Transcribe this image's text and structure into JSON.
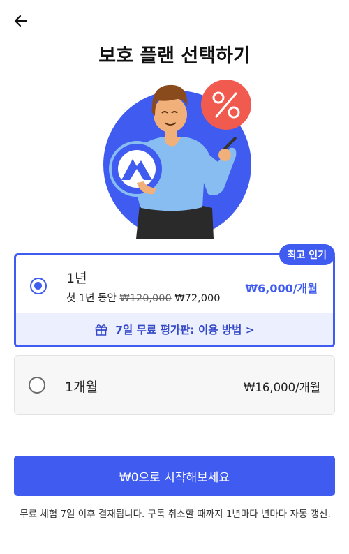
{
  "header": {
    "title": "보호 플랜 선택하기"
  },
  "icons": {
    "back": "back-arrow-icon",
    "gift": "gift-icon",
    "discount": "percent-icon",
    "logo": "mountain-logo-icon"
  },
  "colors": {
    "accent": "#3f5bf0",
    "accent_light": "#eceffd",
    "discount_red": "#f05a4f"
  },
  "plans": [
    {
      "name": "1년",
      "badge": "최고 인기",
      "sub_prefix": "첫 1년 동안 ",
      "original_price": "₩120,000",
      "discount_price": " ₩72,000",
      "price": "₩6,000/개월",
      "selected": true,
      "trial_link": "7일 무료 평가판: 이용 방법 >"
    },
    {
      "name": "1개월",
      "price": "₩16,000/개월",
      "selected": false
    }
  ],
  "cta": {
    "label": "₩0으로 시작해보세요"
  },
  "footer": {
    "disclaimer": "무료 체험 7일 이후 결재됩니다. 구독 취소할 때까지 1년마다 년마다 자동 갱신."
  }
}
